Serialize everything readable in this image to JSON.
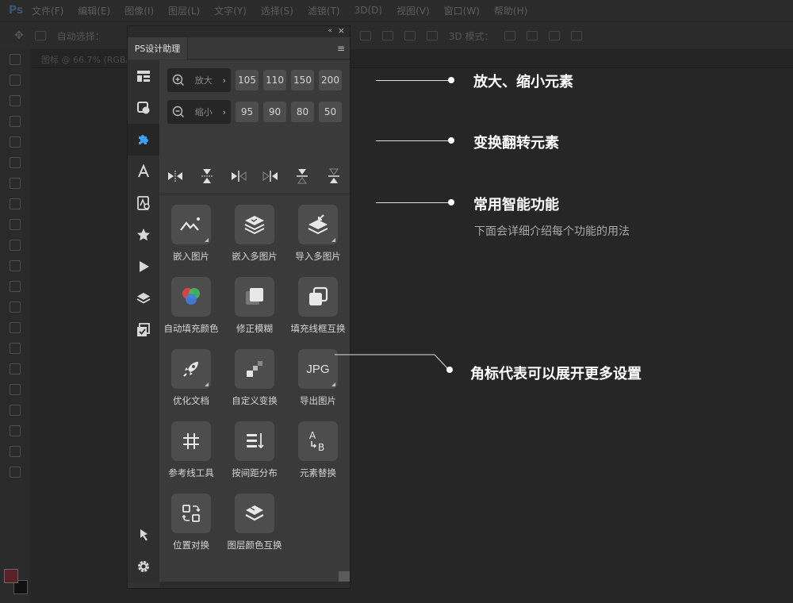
{
  "menubar": {
    "logo": "Ps",
    "items": [
      "文件(F)",
      "编辑(E)",
      "图像(I)",
      "图层(L)",
      "文字(Y)",
      "选择(S)",
      "滤镜(T)",
      "3D(D)",
      "视图(V)",
      "窗口(W)",
      "帮助(H)"
    ]
  },
  "options": {
    "auto_select": "自动选择：",
    "mode_3d": "3D 模式："
  },
  "document": {
    "tab": "图标 @ 66.7% (RGB/8)"
  },
  "panel": {
    "title": "PS设计助理",
    "collapse_icon": "«",
    "close_icon": "×",
    "menu_icon": "≡",
    "zoom_in": {
      "label": "放大",
      "values": [
        "105",
        "110",
        "150",
        "200"
      ]
    },
    "zoom_out": {
      "label": "缩小",
      "values": [
        "95",
        "90",
        "80",
        "50"
      ]
    },
    "tiles": [
      {
        "label": "嵌入图片",
        "icon": "mountain-image-icon",
        "corner": true
      },
      {
        "label": "嵌入多图片",
        "icon": "stack-images-icon",
        "corner": false
      },
      {
        "label": "导入多图片",
        "icon": "import-images-icon",
        "corner": true
      },
      {
        "label": "自动填充颜色",
        "icon": "color-circles-icon",
        "corner": false
      },
      {
        "label": "修正模糊",
        "icon": "fix-blur-icon",
        "corner": false
      },
      {
        "label": "填充线框互换",
        "icon": "fill-stroke-swap-icon",
        "corner": false
      },
      {
        "label": "优化文档",
        "icon": "rocket-icon",
        "corner": true
      },
      {
        "label": "自定义变换",
        "icon": "custom-transform-icon",
        "corner": false
      },
      {
        "label": "导出图片",
        "icon": "jpg-icon",
        "text": "JPG",
        "corner": true
      },
      {
        "label": "参考线工具",
        "icon": "guides-grid-icon",
        "corner": false
      },
      {
        "label": "按间距分布",
        "icon": "distribute-icon",
        "corner": false
      },
      {
        "label": "元素替换",
        "icon": "element-swap-icon",
        "corner": false
      },
      {
        "label": "位置对换",
        "icon": "position-swap-icon",
        "corner": false
      },
      {
        "label": "图层颜色互换",
        "icon": "layer-color-swap-icon",
        "corner": false
      }
    ]
  },
  "annotations": {
    "zoom": "放大、缩小元素",
    "transform": "变换翻转元素",
    "smart": "常用智能功能",
    "smart_sub": "下面会详细介绍每个功能的用法",
    "corner": "角标代表可以展开更多设置"
  },
  "colors": {
    "annotation_text": "#ffffff",
    "panel_bg": "#3a3a3a",
    "tile_bg": "#4d4d4d",
    "foreground_swatch": "#5a2127"
  }
}
